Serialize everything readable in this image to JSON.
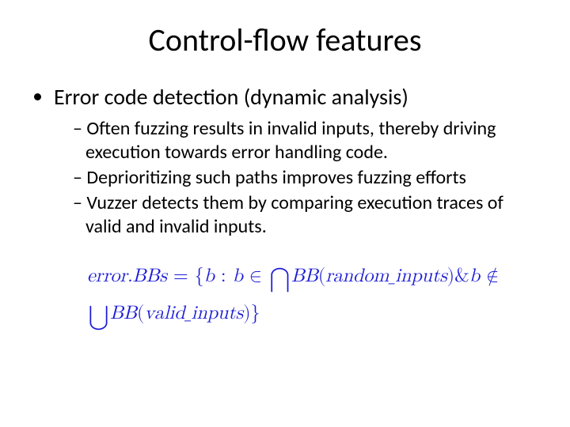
{
  "title": "Control-flow features",
  "bullet1": "Error code detection (dynamic analysis)",
  "sub1": "Often fuzzing results in invalid inputs, thereby driving execution towards error handling code.",
  "sub2": "Deprioritizing such paths improves fuzzing efforts",
  "sub3": "Vuzzer detects them by comparing execution traces of valid and invalid inputs.",
  "formula": {
    "lhs": "error.BBs",
    "eq": " = ",
    "lbrace": "{",
    "b": "b",
    "colon": " : ",
    "bin": " ∈ ",
    "cap": "⋂",
    "bb1": "BB",
    "lp1": "(",
    "rand": "random_inputs",
    "rp1": ")",
    "amp": "&",
    "notin": " ∉ ",
    "cup": "⋃",
    "bb2": "BB",
    "lp2": "(",
    "valid": "valid_inputs",
    "rp2": ")",
    "rbrace": "}"
  }
}
